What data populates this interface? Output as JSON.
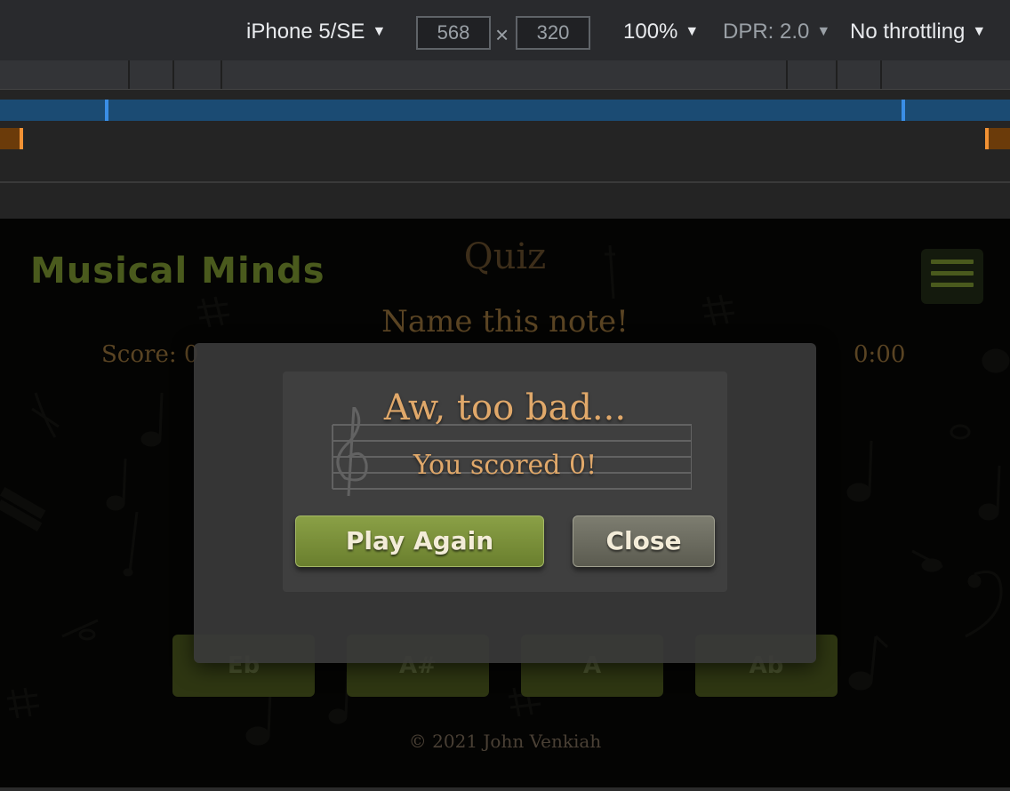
{
  "devtools": {
    "device": "iPhone 5/SE",
    "width": "568",
    "height": "320",
    "times": "×",
    "zoom": "100%",
    "dpr": "DPR: 2.0",
    "throttle": "No throttling",
    "caret": "▼"
  },
  "page": {
    "brand": "Musical Minds",
    "quiz_title": "Quiz",
    "prompt": "Name this note!",
    "score": "Score: 0",
    "timer": "0:00",
    "answers": [
      "Eb",
      "A#",
      "A",
      "Ab"
    ],
    "footer": "© 2021 John Venkiah"
  },
  "modal": {
    "title": "Aw, too bad...",
    "message": "You scored 0!",
    "play_again": "Play Again",
    "close": "Close"
  },
  "colors": {
    "brand": "#4a5a1d",
    "accent_text": "#e0a86a",
    "play_button": "#7a9038",
    "close_button": "#6c6c60"
  }
}
